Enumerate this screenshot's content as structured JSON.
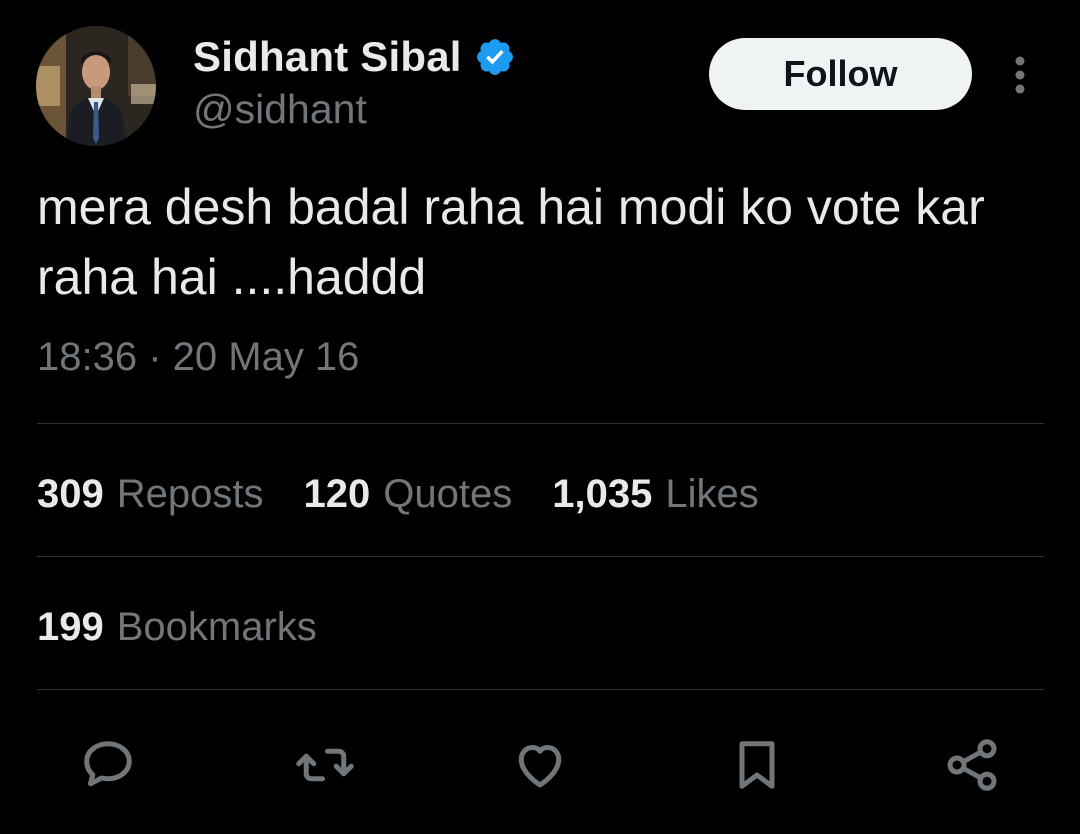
{
  "author": {
    "name": "Sidhant Sibal",
    "handle": "@sidhant",
    "verified": true,
    "avatar_icon": "profile-photo"
  },
  "header": {
    "follow_label": "Follow",
    "more_icon": "more-vertical-icon"
  },
  "tweet": {
    "text": "mera desh badal raha hai modi ko vote kar raha hai ....haddd",
    "timestamp": "18:36 · 20 May 16"
  },
  "stats": {
    "reposts": {
      "count": "309",
      "label": "Reposts"
    },
    "quotes": {
      "count": "120",
      "label": "Quotes"
    },
    "likes": {
      "count": "1,035",
      "label": "Likes"
    },
    "bookmarks": {
      "count": "199",
      "label": "Bookmarks"
    }
  },
  "actions": [
    "reply-icon",
    "repost-icon",
    "like-icon",
    "bookmark-icon",
    "share-icon"
  ],
  "colors": {
    "background": "#000000",
    "primary_text": "#e7e9ea",
    "secondary_text": "#71767b",
    "divider": "#2f3336",
    "verified_blue": "#1d9bf0",
    "follow_bg": "#eff3f4"
  }
}
